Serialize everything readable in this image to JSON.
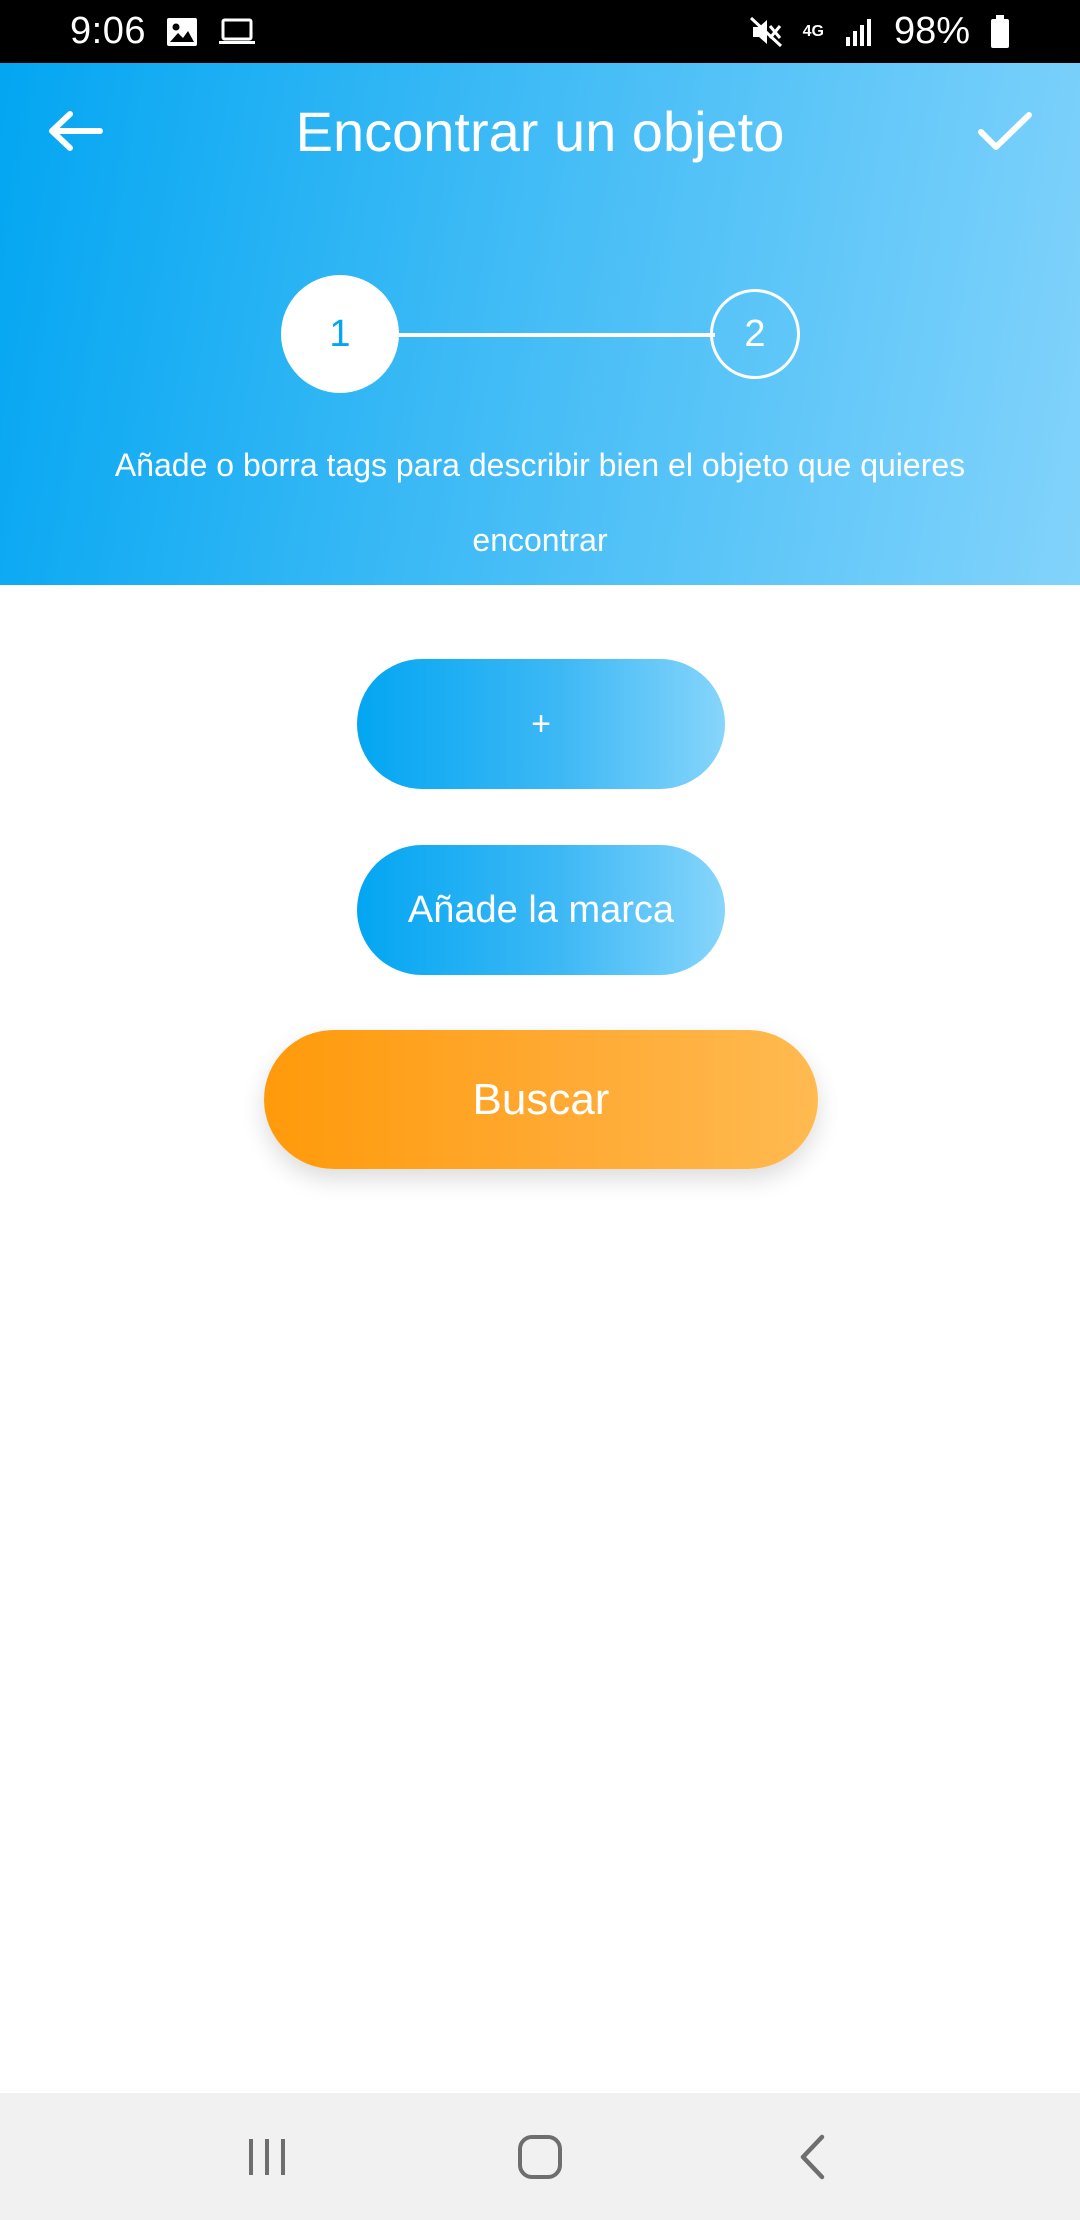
{
  "status_bar": {
    "time": "9:06",
    "network": "4G",
    "battery": "98%",
    "icons": [
      "image-icon",
      "laptop-icon",
      "mute-icon",
      "network-icon",
      "signal-icon",
      "battery-icon"
    ]
  },
  "header": {
    "title": "Encontrar un objeto",
    "back_icon": "arrow-left-icon",
    "confirm_icon": "check-icon",
    "gradient": [
      "#03A6F2",
      "#82D3FB"
    ]
  },
  "stepper": {
    "steps": [
      {
        "label": "1",
        "active": true
      },
      {
        "label": "2",
        "active": false
      }
    ]
  },
  "instructions": "Añade o borra tags para describir bien el objeto que quieres encontrar",
  "content": {
    "add_tag_label": "+",
    "brand_label": "Añade la marca",
    "search_label": "Buscar"
  },
  "colors": {
    "accent_blue": "#03A6F2",
    "accent_orange": "#FF9A0A",
    "nav_background": "#F1F1F1"
  },
  "nav_bar": {
    "icons": [
      "recent-apps-icon",
      "home-icon",
      "back-icon"
    ]
  }
}
